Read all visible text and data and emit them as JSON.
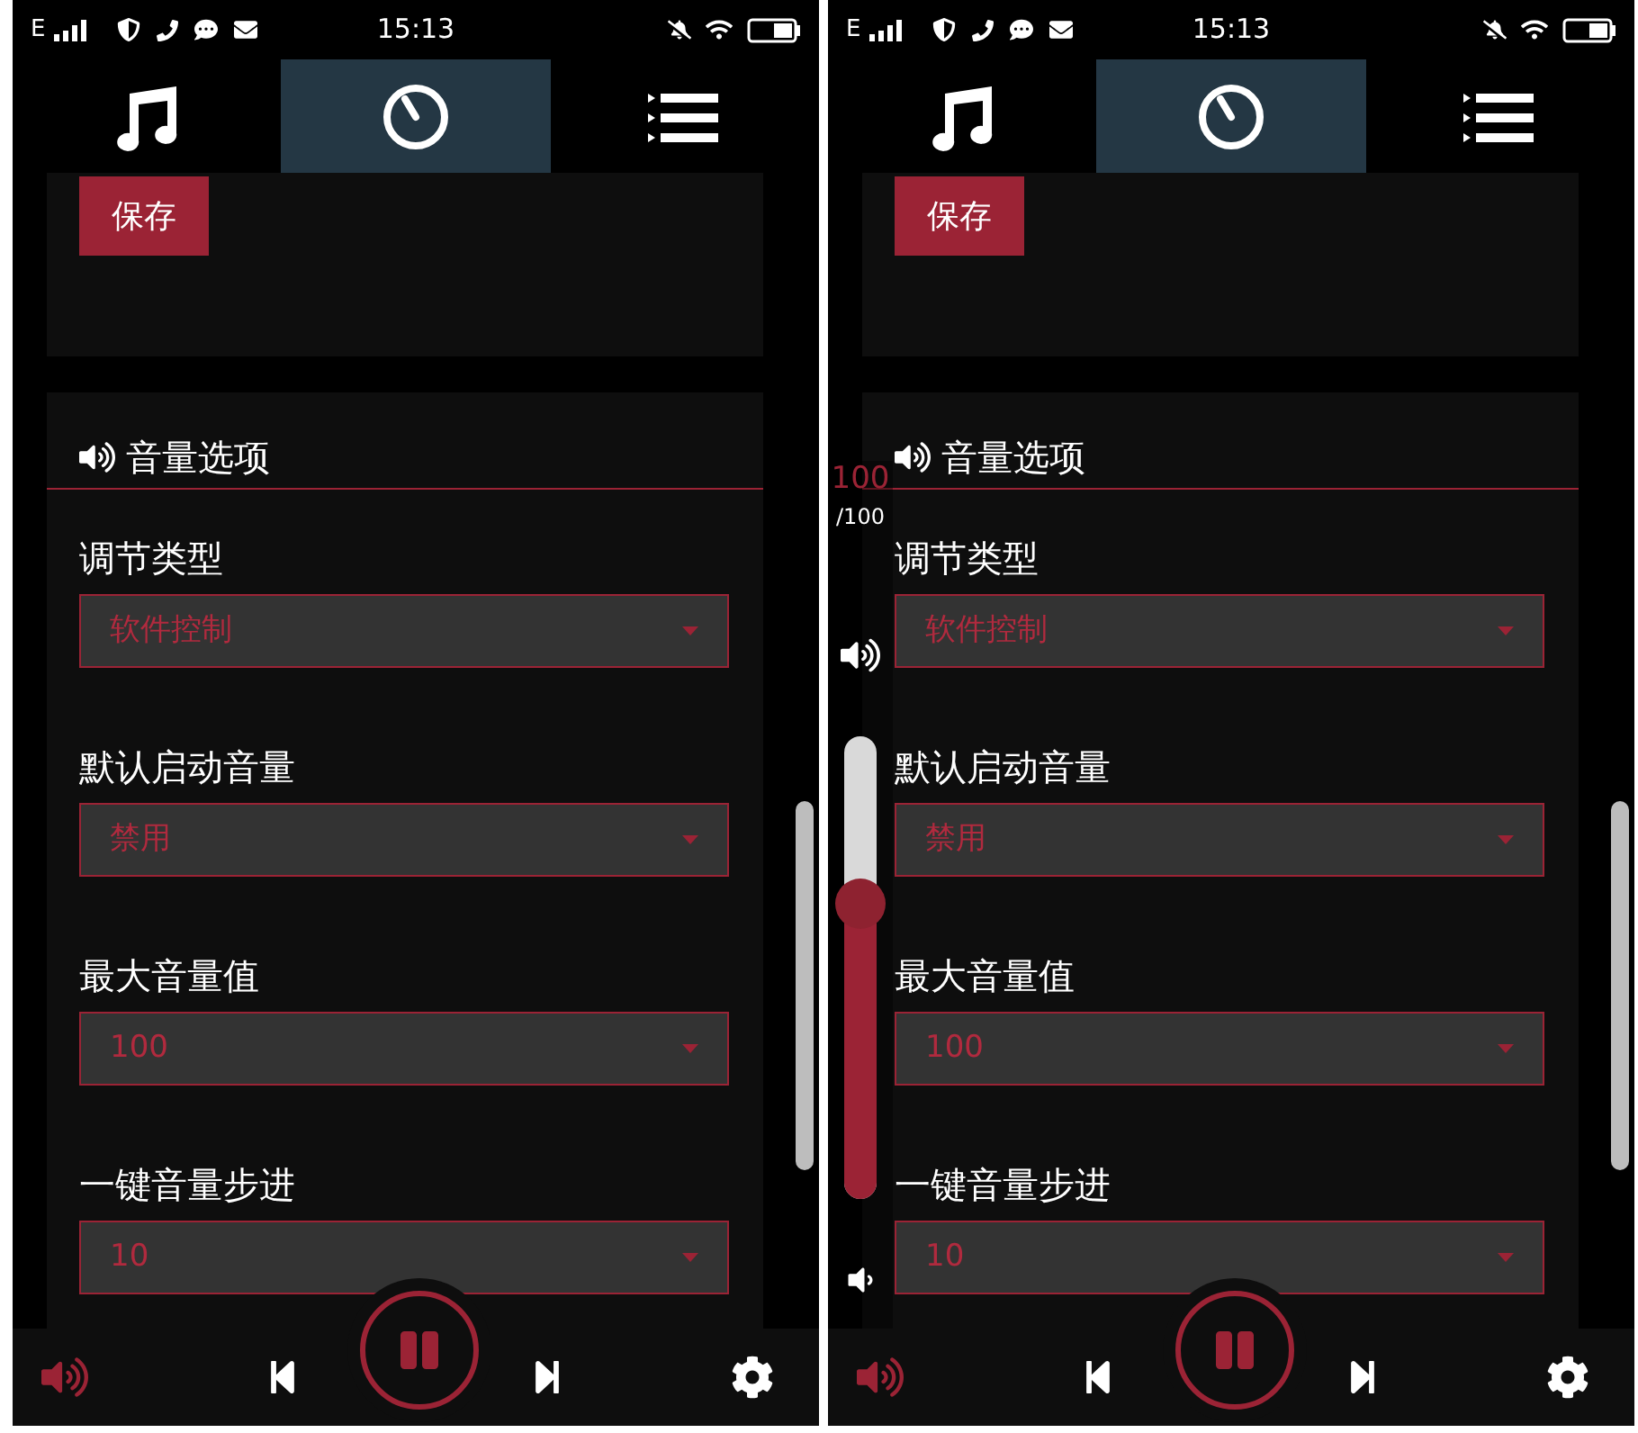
{
  "screens": [
    {
      "status_bar": {
        "network": "E",
        "time": "15:13"
      },
      "tabs": [
        {
          "selected": false
        },
        {
          "selected": true
        },
        {
          "selected": false
        }
      ],
      "save_button": "保存",
      "section": {
        "title": "音量选项"
      },
      "settings": [
        {
          "label": "调节类型",
          "value": "软件控制"
        },
        {
          "label": "默认启动音量",
          "value": "禁用"
        },
        {
          "label": "最大音量值",
          "value": "100"
        },
        {
          "label": "一键音量步进",
          "value": "10"
        }
      ]
    },
    {
      "status_bar": {
        "network": "E",
        "time": "15:13"
      },
      "tabs": [
        {
          "selected": false
        },
        {
          "selected": true
        },
        {
          "selected": false
        }
      ],
      "save_button": "保存",
      "section": {
        "title": "音量选项"
      },
      "settings": [
        {
          "label": "调节类型",
          "value": "软件控制"
        },
        {
          "label": "默认启动音量",
          "value": "禁用"
        },
        {
          "label": "最大音量值",
          "value": "100"
        },
        {
          "label": "一键音量步进",
          "value": "10"
        }
      ],
      "volume_overlay": {
        "reading": "100",
        "max": "/100",
        "level": 0.64
      }
    }
  ]
}
